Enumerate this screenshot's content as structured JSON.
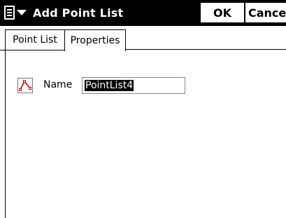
{
  "titlebar": {
    "menu_icon": "document-menu-icon",
    "title": "Add Point List",
    "ok_label": "OK",
    "cancel_label": "Cancel"
  },
  "tabs": [
    {
      "label": "Point List"
    },
    {
      "label": "Properties"
    }
  ],
  "form": {
    "name_label": "Name",
    "name_value": "PointList4",
    "icon": "point-list-icon"
  },
  "colors": {
    "titlebar_bg": "#000000",
    "accent_icon": "#cc0000"
  }
}
